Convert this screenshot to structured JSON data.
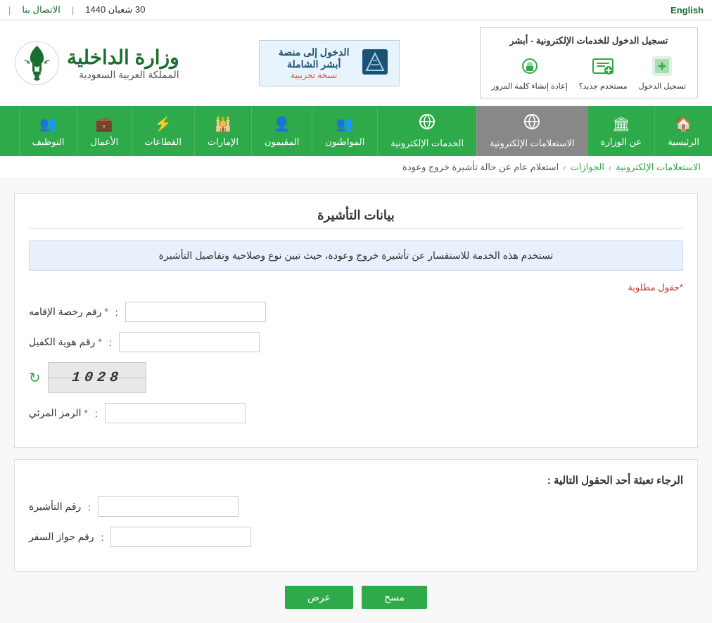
{
  "topbar": {
    "date": "30 شعبان 1440",
    "contact": "الاتصال بنا",
    "english": "English",
    "separator1": "|",
    "separator2": "|"
  },
  "header": {
    "login_title": "تسجيل الدخول للخدمات الإلكترونية - أبشر",
    "action1_label": "تسجيل الدخول",
    "action2_label": "مستخدم جديد؟",
    "action3_label": "إعادة إنشاء كلمة المرور",
    "logo_title": "وزارة الداخلية",
    "logo_subtitle": "المملكة العربية السعودية"
  },
  "absher": {
    "main_text": "الدخول إلى منصة أبشر الشاملة",
    "sub_text": "نسخة تجريبية"
  },
  "nav": {
    "items": [
      {
        "label": "الرئيسية",
        "icon": "🏠"
      },
      {
        "label": "عن الوزارة",
        "icon": "🏛"
      },
      {
        "label": "الاستعلامات الإلكترونية",
        "icon": "🌐",
        "active": true
      },
      {
        "label": "الخدمات الإلكترونية",
        "icon": "🌐"
      },
      {
        "label": "المواطنون",
        "icon": "👥"
      },
      {
        "label": "المقيمون",
        "icon": "👤"
      },
      {
        "label": "الإمارات",
        "icon": "🕌"
      },
      {
        "label": "القطاعات",
        "icon": "⚡"
      },
      {
        "label": "الأعمال",
        "icon": "💼"
      },
      {
        "label": "التوظيف",
        "icon": "👥"
      }
    ]
  },
  "breadcrumb": {
    "link1": "الاستعلامات الإلكترونية",
    "sep1": "›",
    "link2": "الجوازات",
    "sep2": "›",
    "current": "استعلام عام عن حالة تأشيرة خروج وعودة"
  },
  "form": {
    "section_title": "بيانات التأشيرة",
    "info_text": "تستخدم هذه الخدمة للاستفسار عن تأشيرة خروج وعودة، حيث تبين نوع وصلاحية وتفاصيل التأشيرة",
    "required_note": "*حقول مطلوبة",
    "field1_label": "رقم رخصة الإقامه",
    "field1_required": "*",
    "field2_label": "رقم هوية الكفيل",
    "field2_required": "*",
    "captcha_text": "1028",
    "captcha_label": "الرمز المرئي",
    "captcha_required": "*",
    "section2_title": "الرجاء تعبئة أحد الحقول التالية :",
    "field3_label": "رقم التأشيرة",
    "field4_label": "رقم جواز السفر",
    "btn_view": "عرض",
    "btn_clear": "مسح"
  }
}
